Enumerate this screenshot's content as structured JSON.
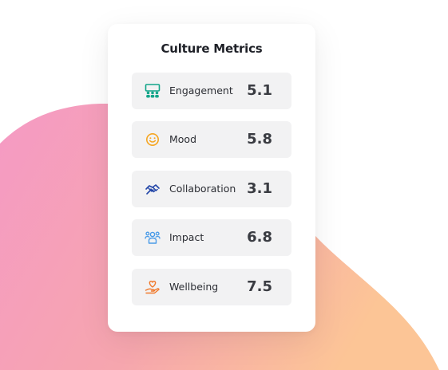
{
  "card": {
    "title": "Culture Metrics"
  },
  "metrics": [
    {
      "label": "Engagement",
      "value": "5.1",
      "icon": "people-board-icon",
      "color": "#12a589"
    },
    {
      "label": "Mood",
      "value": "5.8",
      "icon": "smiley-icon",
      "color": "#f5a623"
    },
    {
      "label": "Collaboration",
      "value": "3.1",
      "icon": "handshake-icon",
      "color": "#2346a8"
    },
    {
      "label": "Impact",
      "value": "6.8",
      "icon": "group-icon",
      "color": "#4a9be8"
    },
    {
      "label": "Wellbeing",
      "value": "7.5",
      "icon": "heart-hand-icon",
      "color": "#f0782a"
    }
  ],
  "colors": {
    "background_blob_start": "#f59ac4",
    "background_blob_end": "#fbc79c"
  }
}
